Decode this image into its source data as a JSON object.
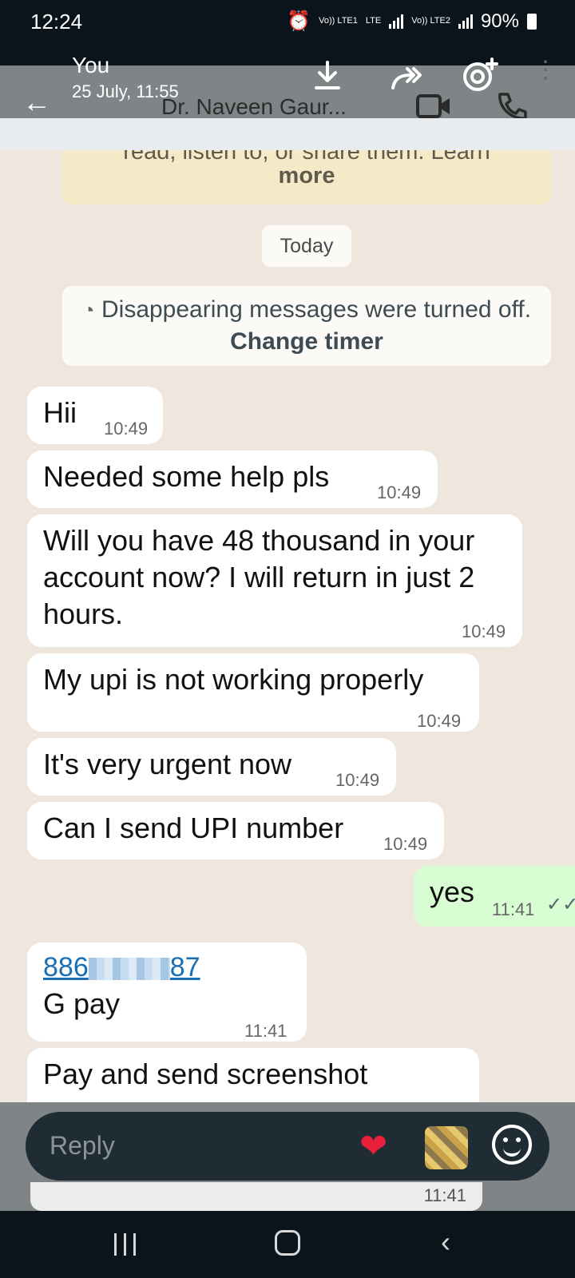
{
  "status_bar": {
    "time": "12:24",
    "sim1_label": "Vo)) LTE1",
    "lte_label": "LTE",
    "sim2_label": "Vo)) LTE2",
    "battery": "90%"
  },
  "header": {
    "sender": "You",
    "date": "25 July, 11:55",
    "contact_name": "Dr. Naveen Gaur..."
  },
  "notice": {
    "line1": "read, listen to, or share them. Learn",
    "line2": "more"
  },
  "date_chip": "Today",
  "system_message": {
    "text": "Disappearing messages were turned off.",
    "action": "Change timer"
  },
  "messages": [
    {
      "text": "Hii",
      "time": "10:49",
      "direction": "in"
    },
    {
      "text": "Needed some help pls",
      "time": "10:49",
      "direction": "in"
    },
    {
      "text": "Will you have 48 thousand in your account now? I will return in just 2 hours.",
      "time": "10:49",
      "direction": "in"
    },
    {
      "text": "My upi is not working properly",
      "time": "10:49",
      "direction": "in"
    },
    {
      "text": "It's very urgent now",
      "time": "10:49",
      "direction": "in"
    },
    {
      "text": "Can I send UPI number",
      "time": "10:49",
      "direction": "in"
    },
    {
      "text": "yes",
      "time": "11:41",
      "direction": "out"
    },
    {
      "link_prefix": "886",
      "link_suffix": "87",
      "text": "G pay",
      "time": "11:41",
      "direction": "in"
    },
    {
      "text": "Pay and send screenshot",
      "time": "11:41",
      "direction": "in"
    }
  ],
  "last_time": "11:41",
  "reply_bar": {
    "placeholder": "Reply"
  },
  "colors": {
    "chat_bg": "#efe7de",
    "outgoing_bubble": "#d9fdd3",
    "link": "#1a6fb4",
    "read_ticks": "#53bdeb"
  }
}
